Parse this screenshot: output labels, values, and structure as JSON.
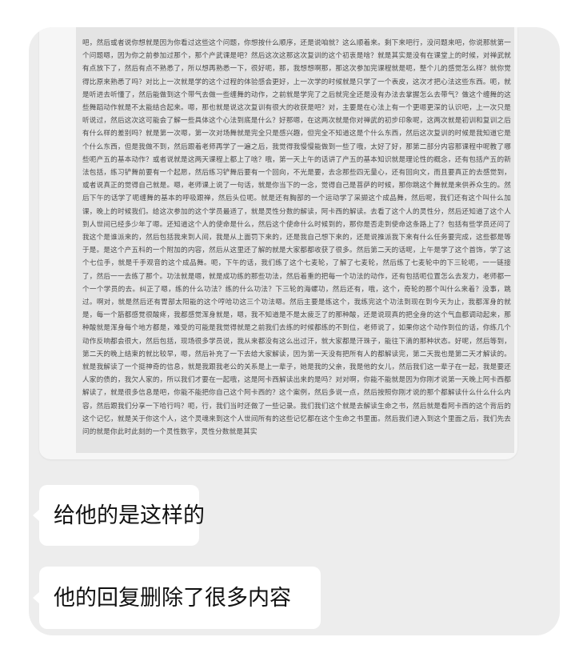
{
  "chat": {
    "document_text": "吧，然后或者说你想就是因为你看过这些这个问题，你想按什么顺序，还是说咱就？这么顺着来。剩下来吧行，没问题来吧，你说那就第一个问题嗯，因为你之前参加过那个，那个产武课是吧？然后这次这那这次复训的这个初衷是啥？就是其实是没有在课堂上的时候，对禅武就有点放下了，然后有点不熟悉了，所以想再熟悉一下，很好呃，那，我想想啊那，那这次参加完课程就是呃，整个儿的感觉怎么样？就你觉得比原来熟悉了吗？对比上一次就是学的这个过程的体验感会更好，上一次学的时候就是只学了一个表皮，这次才把心法这些东西。呃，就是听进去听懂了，然后能做到这个带气去做一些缠舞的动作，之前就是学完了之后就完全还是没有办法去掌握怎么去带气？做这个缠舞的这些舞蹈动作就是不太能结合起来。嗯，那也就是说这次复训有很大的收获是吧？对，主要是在心法上有一个更嗯更深的认识吧，上一次只是听说过，然后这次这可能会了解一些具体这个心法到底是什么？好那嗯，在这两次就是你对禅武的初步印象呢，这两次就是初训和复训之后有什么样的差别吗？就是第一次嗯，第一次对场舞就是完全只是感兴趣，但完全不知道这是个什么东西，然后这次复训的时候是我知道它是个什么东西，但是我做不到，然后跟着老师再学了一遍之后，我觉得我慢慢能做到一些了哦，太好了好，那第二部分内容那课程中呢教了哪些呃产五的基本动作？或者说就是这两天课程上都上了啥？哦，第一天上午的话讲了产五的基本知识就是理论性的概念，还有包括产五的新法包括，练习铲舞前要有一个起愿，然后练习铲舞后要有一个回向，不光是要，去念那些四无量心，还有回向文，而且要真正的去感觉到，或者说真正的觉得自己就是。嗯，老师课上说了一句话，就是你当下的一念，觉得自己是菩萨的时候，那你跳这个舞就是来供养众生的。然后下午的话学了呃缠舞的基本的呼吸跟禅，然后头位呃。就是还有胸部的一个运动学了采撷这个成品舞，然后呢，我们还有这个叫什么加课，晚上的时候我们。给这次参加的这个学员最适了，就是灵性分数的解读，阿卡西的解读。去看了这个人的灵性分，然后还知道了这个人到人世间已经多少年了嗯。还知道这个人的使命是什么，然后这个使命什么时候到的，那你是否走到使命这条路上了？包括有些学员还问了我这个是谁派来的，然后包括我来到人间，我是从上面罚下来的，还是我自己想下来的，还是说推派我下来有什么任务要完成，这些都是等于是。是这个产五科的一个附加的内容，然后从这里还了解的就是大家都都收获了很多。然后第二天的话呢，上午是学了这个首饰，学了这个七位手，就是千手观音的这个成品舞。呃，下午的话，我们练了这个七麦轮，了解了七麦轮，然后练了七麦轮中的下三轮呃，一一链接了，然后一一去练了那个。功法就是嗯，就是成功练的那些功法，然后着重的把每一个功法的动作，还有包括呃位置怎么去发力，老师都一个一个学员的去。纠正了嗯，练的什么功法？练的什么功法？下三轮的海螺功，然后还有，哦，这个，奇轮的那个叫什么来着？没事，跳过。啊对，就是然后还有胃部太阳能的这个哼哈功这三个功法嗯。然后主要是练这个，我练完这个功法到现在到今天为止，我都浑身的就是，每一个筋都感觉很酸疼，我都感觉浑身就是，嗯，我不知道是不是太疲乏了的那种酸，还是说现真的把全身的这个气血都调动起来，那种酸就是浑身每个地方都是，难受的可能是我觉得就是之前我们去练的时候都练的不到位，老师说了，如果你这个动作到位的话，你练几个动作反响都会很大，然后包括，现场很多学员说，我从来都没有这么出过汗，就大家都是汗珠子，能往下滴的那种状态。好呢，然后等到，第二天的晚上结束的就比较早，嗯，然后补充了一下去给大家解读，因为第一天没有把所有人的都解读完，第二天我也是第二天才解读的。就是我解读了一个挺神奇的信息，就是我跟我老公的关系是上一辈子，她是我的父亲，我是他的女儿，然后我们这一辈子在一起，我是要还人家的债的，我欠人家的，所以我们才要在一起哦，这是阿卡西解读出来的是吗？对对啊，你能不能就是因为你刚才说第一天晚上阿卡西都解读了，就是很多信息是吧，你能不能把你自己这个阿卡西的？这个案例，然后多说一点，然后按照你刚才说的那个都解读什么什么什么内容，然后跟我们分享一下哈行吗？呃，行，我们当时还做了一些记录。我们我们这个就是去解读生命之书，然后就是看阿卡西的这个背后的这个记忆，就是关于你这个人，这个灵魂来到这个人世间所有的这些记忆都在这个生命之书里面。然后我们进入到这个里面之后，我们先去问的就是你此时此刻的一个灵性数字，灵性分数就是其实",
    "messages": [
      "给他的是这样的",
      "他的回复删除了很多内容"
    ]
  }
}
